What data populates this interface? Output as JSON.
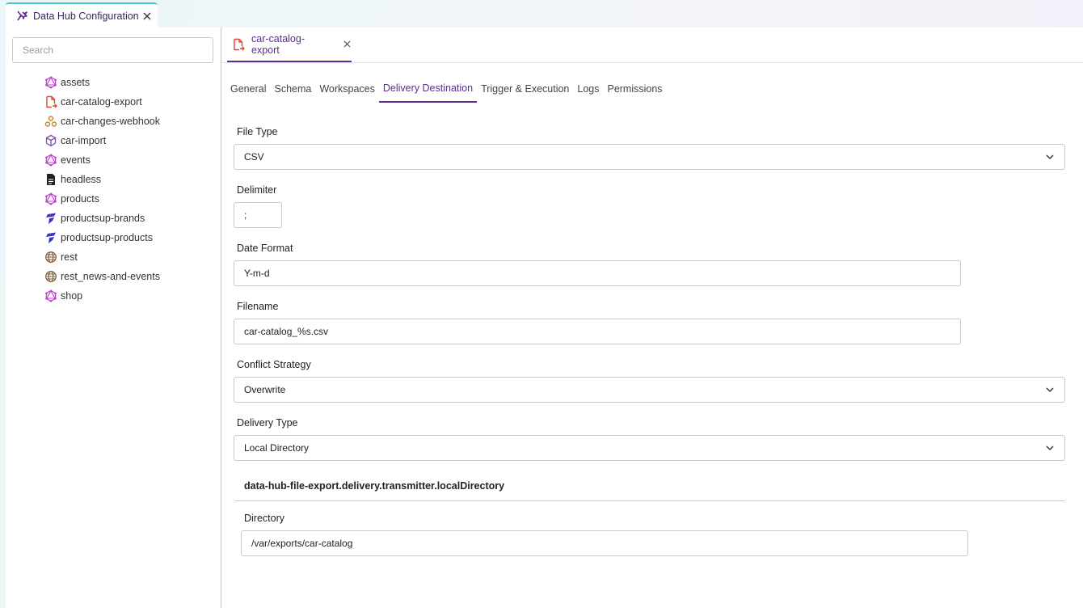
{
  "app_tab": {
    "title": "Data Hub Configuration"
  },
  "search": {
    "placeholder": "Search"
  },
  "tree": {
    "items": [
      {
        "label": "assets",
        "icon": "graphql-icon"
      },
      {
        "label": "car-catalog-export",
        "icon": "file-export-icon"
      },
      {
        "label": "car-changes-webhook",
        "icon": "webhook-icon"
      },
      {
        "label": "car-import",
        "icon": "cube-import-icon"
      },
      {
        "label": "events",
        "icon": "graphql-icon"
      },
      {
        "label": "headless",
        "icon": "document-icon"
      },
      {
        "label": "products",
        "icon": "graphql-icon"
      },
      {
        "label": "productsup-brands",
        "icon": "productsup-icon"
      },
      {
        "label": "productsup-products",
        "icon": "productsup-icon"
      },
      {
        "label": "rest",
        "icon": "globe-icon"
      },
      {
        "label": "rest_news-and-events",
        "icon": "globe-icon"
      },
      {
        "label": "shop",
        "icon": "graphql-icon"
      }
    ]
  },
  "doc_tab": {
    "label": "car-catalog-export"
  },
  "sub_tabs": [
    "General",
    "Schema",
    "Workspaces",
    "Delivery Destination",
    "Trigger & Execution",
    "Logs",
    "Permissions"
  ],
  "form": {
    "file_type": {
      "label": "File Type",
      "value": "CSV"
    },
    "delimiter": {
      "label": "Delimiter",
      "value": ";"
    },
    "date_format": {
      "label": "Date Format",
      "value": "Y-m-d"
    },
    "filename": {
      "label": "Filename",
      "value": "car-catalog_%s.csv"
    },
    "conflict_strategy": {
      "label": "Conflict Strategy",
      "value": "Overwrite"
    },
    "delivery_type": {
      "label": "Delivery Type",
      "value": "Local Directory"
    },
    "section_title": "data-hub-file-export.delivery.transmitter.localDirectory",
    "directory": {
      "label": "Directory",
      "value": "/var/exports/car-catalog"
    }
  },
  "colors": {
    "accent": "#5b2d90",
    "graphql": "#c13fd0",
    "export": "#e0452d",
    "webhook": "#c9882a",
    "productsup": "#3a36c6",
    "globe": "#7a5a3a"
  }
}
